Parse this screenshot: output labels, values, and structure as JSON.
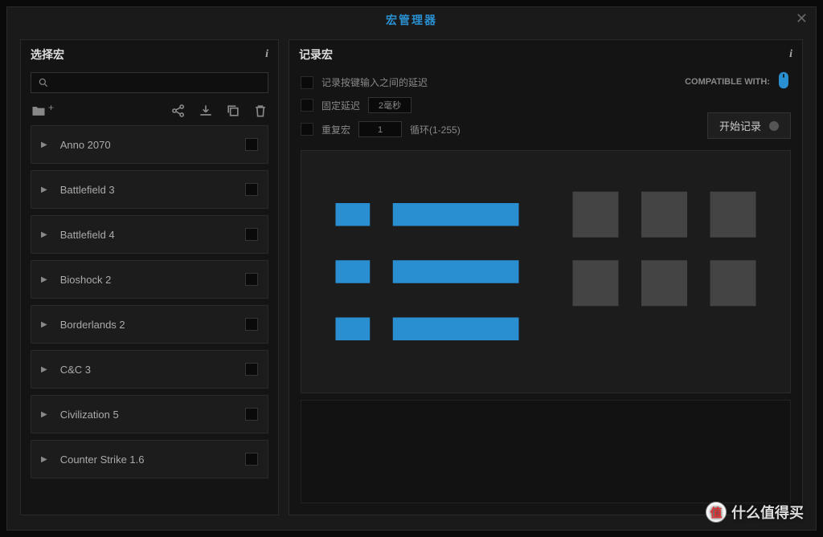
{
  "dialog": {
    "title": "宏管理器"
  },
  "leftPanel": {
    "title": "选择宏",
    "searchPlaceholder": "",
    "macros": [
      {
        "name": "Anno 2070"
      },
      {
        "name": "Battlefield 3"
      },
      {
        "name": "Battlefield 4"
      },
      {
        "name": "Bioshock 2"
      },
      {
        "name": "Borderlands 2"
      },
      {
        "name": "C&C 3"
      },
      {
        "name": "Civilization 5"
      },
      {
        "name": "Counter Strike 1.6"
      }
    ]
  },
  "rightPanel": {
    "title": "记录宏",
    "option1": "记录按键输入之间的延迟",
    "option2": "固定延迟",
    "option2Value": "2毫秒",
    "option3": "重复宏",
    "option3Value": "1",
    "option3Hint": "循环(1-255)",
    "compatLabel": "COMPATIBLE WITH:",
    "recordBtn": "开始记录"
  },
  "watermark": "什么值得买",
  "watermarkBadge": "值"
}
